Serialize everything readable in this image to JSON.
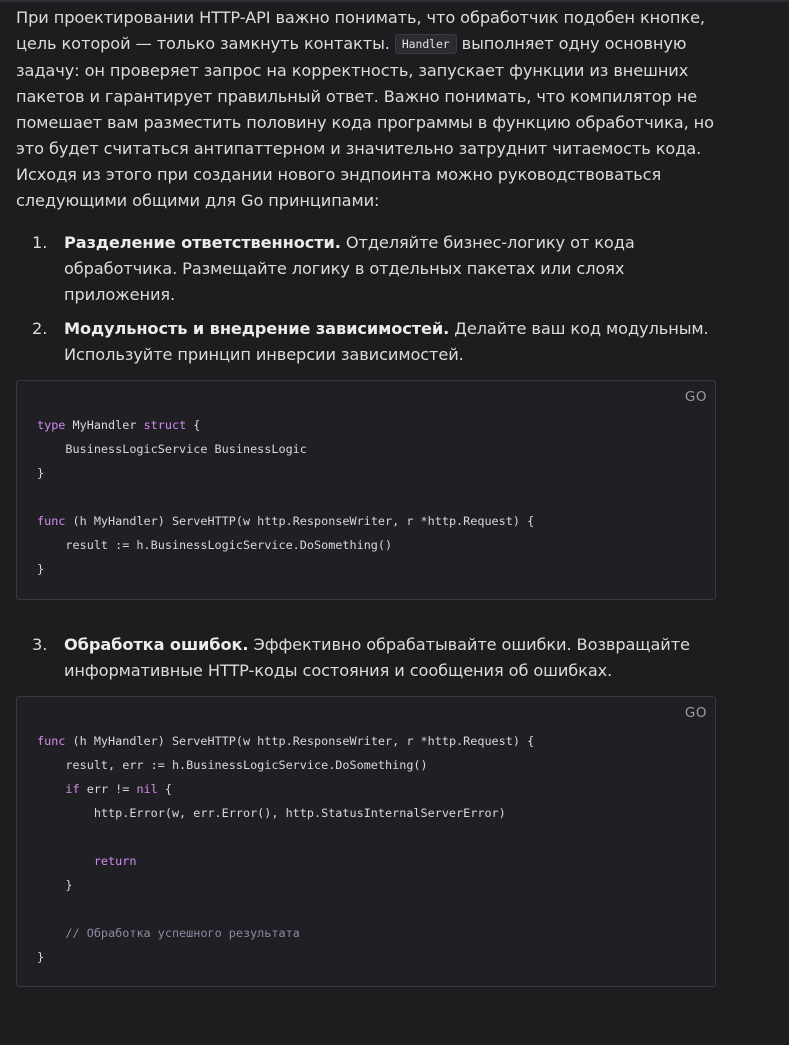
{
  "intro": {
    "p1_before": "При проектировании HTTP-API важно понимать, что обработчик подобен кнопке, цель которой — только замкнуть контакты.",
    "p1_code": "Handler",
    "p1_after": "выполняет одну основную задачу: он проверяет запрос на корректность, запускает функции из внешних пакетов и гарантирует правильный ответ. Важно понимать, что компилятор не помешает вам разместить половину кода программы в функцию обработчика, но это будет считаться антипаттерном и значительно затруднит читаемость кода.",
    "p2": "Исходя из этого при создании нового эндпоинта можно руководствоваться следующими общими для Go принципами:"
  },
  "list1": [
    {
      "num": "1.",
      "title": "Разделение ответственности.",
      "text": "Отделяйте бизнес-логику от кода обработчика. Размещайте логику в отдельных пакетах или слоях приложения."
    },
    {
      "num": "2.",
      "title": "Модульность и внедрение зависимостей.",
      "text": "Делайте ваш код модульным. Используйте принцип инверсии зависимостей."
    }
  ],
  "code1": {
    "lang": "GO",
    "lines": [
      [
        {
          "t": "type",
          "c": "kw"
        },
        {
          "t": " MyHandler "
        },
        {
          "t": "struct",
          "c": "kw"
        },
        {
          "t": " {"
        }
      ],
      [
        {
          "t": "    BusinessLogicService BusinessLogic"
        }
      ],
      [
        {
          "t": "}"
        }
      ],
      [
        {
          "t": ""
        }
      ],
      [
        {
          "t": "func",
          "c": "kw"
        },
        {
          "t": " (h MyHandler) ServeHTTP(w http.ResponseWriter, r *http.Request) {"
        }
      ],
      [
        {
          "t": "    result := h.BusinessLogicService.DoSomething()"
        }
      ],
      [
        {
          "t": "}"
        }
      ]
    ]
  },
  "list2": [
    {
      "num": "3.",
      "title": "Обработка ошибок.",
      "text": "Эффективно обрабатывайте ошибки. Возвращайте информативные HTTP-коды состояния и сообщения об ошибках."
    }
  ],
  "code2": {
    "lang": "GO",
    "lines": [
      [
        {
          "t": "func",
          "c": "kw"
        },
        {
          "t": " (h MyHandler) ServeHTTP(w http.ResponseWriter, r *http.Request) {"
        }
      ],
      [
        {
          "t": "    result, err := h.BusinessLogicService.DoSomething()"
        }
      ],
      [
        {
          "t": "    "
        },
        {
          "t": "if",
          "c": "kw"
        },
        {
          "t": " err != "
        },
        {
          "t": "nil",
          "c": "kw"
        },
        {
          "t": " {"
        }
      ],
      [
        {
          "t": "        http.Error(w, err.Error(), http.StatusInternalServerError)"
        }
      ],
      [
        {
          "t": ""
        }
      ],
      [
        {
          "t": "        "
        },
        {
          "t": "return",
          "c": "kw"
        }
      ],
      [
        {
          "t": "    }"
        }
      ],
      [
        {
          "t": ""
        }
      ],
      [
        {
          "t": "    "
        },
        {
          "t": "// Обработка успешного результата",
          "c": "cm"
        }
      ],
      [
        {
          "t": "}"
        }
      ]
    ]
  },
  "colors": {
    "background": "#1d1d20",
    "text": "#dcdcde",
    "code_background": "#202024",
    "keyword": "#d38bef",
    "comment": "#8a8aa3"
  }
}
